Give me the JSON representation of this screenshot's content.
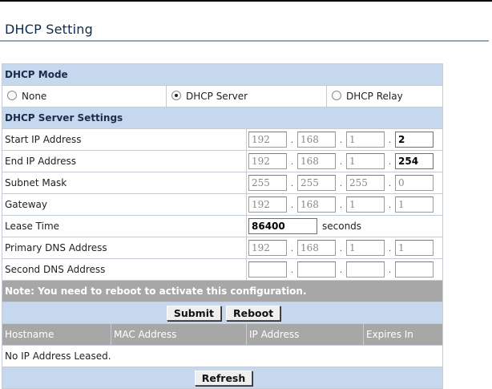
{
  "page": {
    "title": "DHCP Setting"
  },
  "dhcp_mode": {
    "heading": "DHCP Mode",
    "options": [
      "None",
      "DHCP Server",
      "DHCP Relay"
    ],
    "selected": "DHCP Server"
  },
  "server_settings": {
    "heading": "DHCP Server Settings",
    "start_ip": {
      "label": "Start IP Address",
      "octets": [
        "192",
        "168",
        "1",
        "2"
      ]
    },
    "end_ip": {
      "label": "End IP Address",
      "octets": [
        "192",
        "168",
        "1",
        "254"
      ]
    },
    "subnet": {
      "label": "Subnet Mask",
      "octets": [
        "255",
        "255",
        "255",
        "0"
      ]
    },
    "gateway": {
      "label": "Gateway",
      "octets": [
        "192",
        "168",
        "1",
        "1"
      ]
    },
    "lease": {
      "label": "Lease Time",
      "value": "86400",
      "unit": "seconds"
    },
    "primary_dns": {
      "label": "Primary DNS Address",
      "octets": [
        "192",
        "168",
        "1",
        "1"
      ]
    },
    "second_dns": {
      "label": "Second DNS Address",
      "octets": [
        "",
        "",
        "",
        ""
      ]
    }
  },
  "note": "Note: You need to reboot to activate this configuration.",
  "buttons": {
    "submit": "Submit",
    "reboot": "Reboot",
    "refresh": "Refresh"
  },
  "leases": {
    "columns": [
      "Hostname",
      "MAC Address",
      "IP Address",
      "Expires In"
    ],
    "empty_text": "No IP Address Leased."
  }
}
